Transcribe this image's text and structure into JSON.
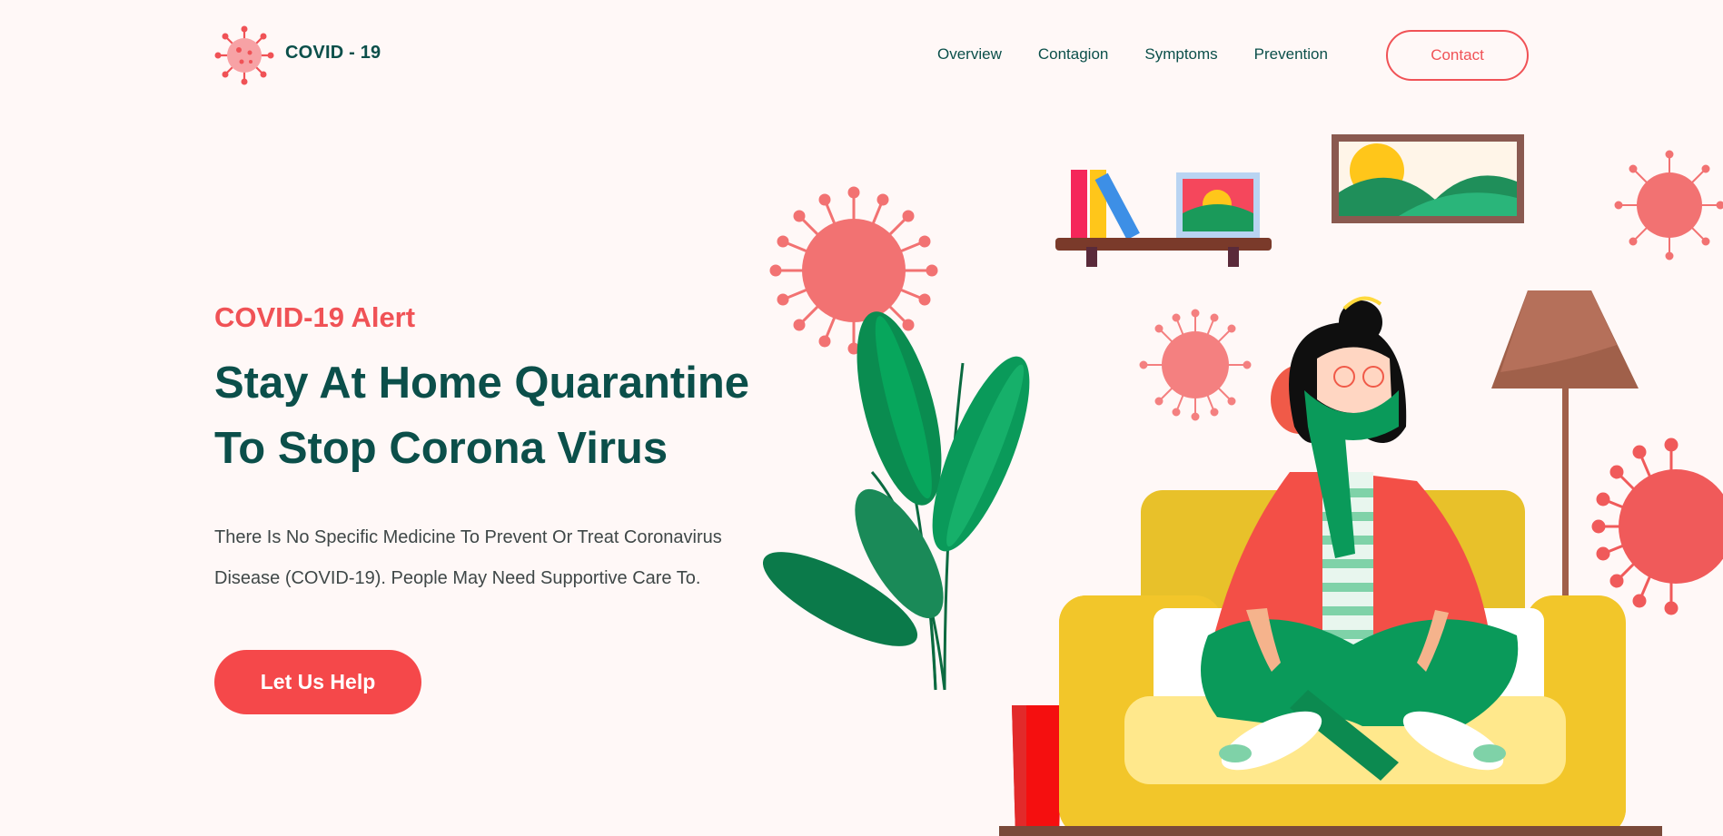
{
  "brand": {
    "name": "COVID - 19",
    "logo_icon": "virus-icon"
  },
  "nav": {
    "items": [
      "Overview",
      "Contagion",
      "Symptoms",
      "Prevention"
    ],
    "contact_label": "Contact"
  },
  "hero": {
    "eyebrow": "COVID-19 Alert",
    "headline_line1": "Stay At Home Quarantine",
    "headline_line2": "To Stop Corona Virus",
    "description_line1": "There Is No Specific Medicine To Prevent Or Treat Coronavirus",
    "description_line2": "Disease (COVID-19). People May Need Supportive Care To.",
    "cta_label": "Let Us Help"
  },
  "colors": {
    "background": "#fff8f7",
    "brand_dark": "#0b4f4a",
    "accent_red": "#f05256",
    "sofa_yellow": "#f2c62a",
    "plant_green": "#0a9a5a"
  }
}
